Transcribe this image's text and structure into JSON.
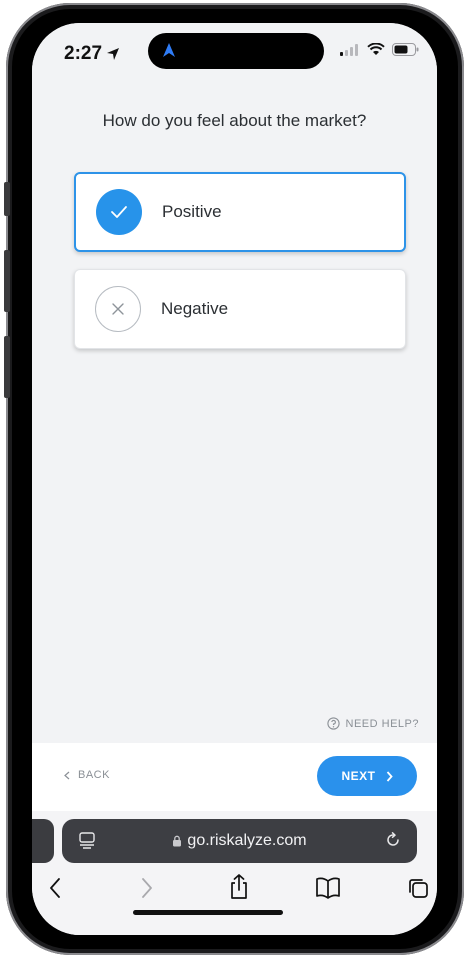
{
  "status_bar": {
    "time": "2:27",
    "location_icon": "location-arrow-icon",
    "signal_icon": "cellular-signal-icon",
    "wifi_icon": "wifi-icon",
    "battery_icon": "battery-icon"
  },
  "question": "How do you feel about the market?",
  "options": [
    {
      "label": "Positive",
      "selected": true,
      "icon": "checkmark-icon"
    },
    {
      "label": "Negative",
      "selected": false,
      "icon": "close-x-icon"
    }
  ],
  "help": {
    "label": "NEED HELP?",
    "icon": "question-circle-icon"
  },
  "footer": {
    "back_label": "BACK",
    "next_label": "NEXT"
  },
  "browser": {
    "url": "go.riskalyze.com",
    "lock_icon": "lock-icon"
  },
  "colors": {
    "accent": "#2a91ec",
    "background": "#f2f3f5",
    "url_bar": "#3d3e43"
  }
}
